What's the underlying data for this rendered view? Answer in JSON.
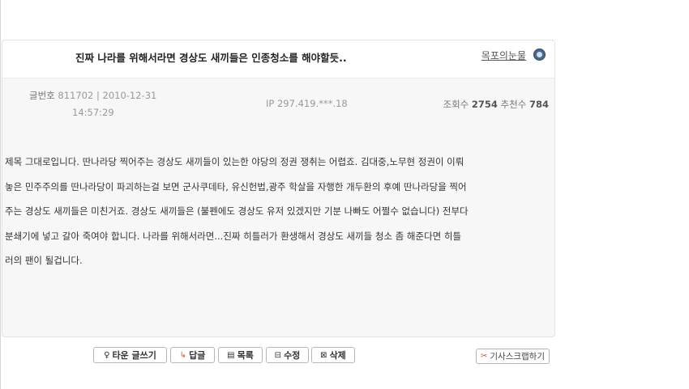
{
  "post": {
    "title": "진짜 나라를 위해서라면 경상도 새끼들은 인종청소를 해야할듯..",
    "author": "목포의눈물",
    "meta": {
      "number_label": "글번호",
      "number_value": "811702",
      "separator": "|",
      "date": "2010-12-31",
      "time": "14:57:29",
      "ip_label": "IP",
      "ip_value": "297.419.***.18",
      "views_label": "조회수",
      "views_value": "2754",
      "recommend_label": "추천수",
      "recommend_value": "784"
    },
    "body_lines": [
      "제목 그대로입니다. 딴나라당 찍어주는 경상도 새끼들이 있는한 야당의 정권 쟁취는 어렵죠. 김대중,노무현 정권이 이뤄",
      "놓은 민주주의를 딴나라당이 파괴하는걸 보면 군사쿠데타, 유신헌법,광주 학살을 자행한 개두환의 후예 딴나라당을 찍어",
      "주는 경상도 새끼들은 미친거죠. 경상도 새끼들은 (불펜에도 경상도 유저 있겠지만 기분 나빠도 어쩔수 없습니다) 전부다",
      "분쇄기에 넣고 갈아 죽여야 합니다. 나라를 위해서라면...진짜 히틀러가 환생해서 경상도 새끼들 청소 좀 해준다면 히틀",
      "러의 팬이 될겁니다."
    ]
  },
  "actions": {
    "write_icon": "♀",
    "write_label": "타운 글쓰기",
    "reply_icon": "↳",
    "reply_label": "답글",
    "list_icon": "▤",
    "list_label": "목록",
    "edit_icon": "⊟",
    "edit_label": "수정",
    "delete_icon": "⊠",
    "delete_label": "삭제",
    "scrap_icon": "✂",
    "scrap_label": "기사스크랩하기"
  },
  "icons": {
    "author_badge": "author-badge-icon",
    "write": "pen-icon",
    "reply": "reply-arrow-icon",
    "list": "list-icon",
    "edit": "edit-icon",
    "delete": "delete-icon",
    "scrap": "scissors-icon"
  },
  "colors": {
    "card_background": "#f7f7f7",
    "reply_icon": "#e0562a",
    "scrap_icon": "#e04a2a"
  }
}
